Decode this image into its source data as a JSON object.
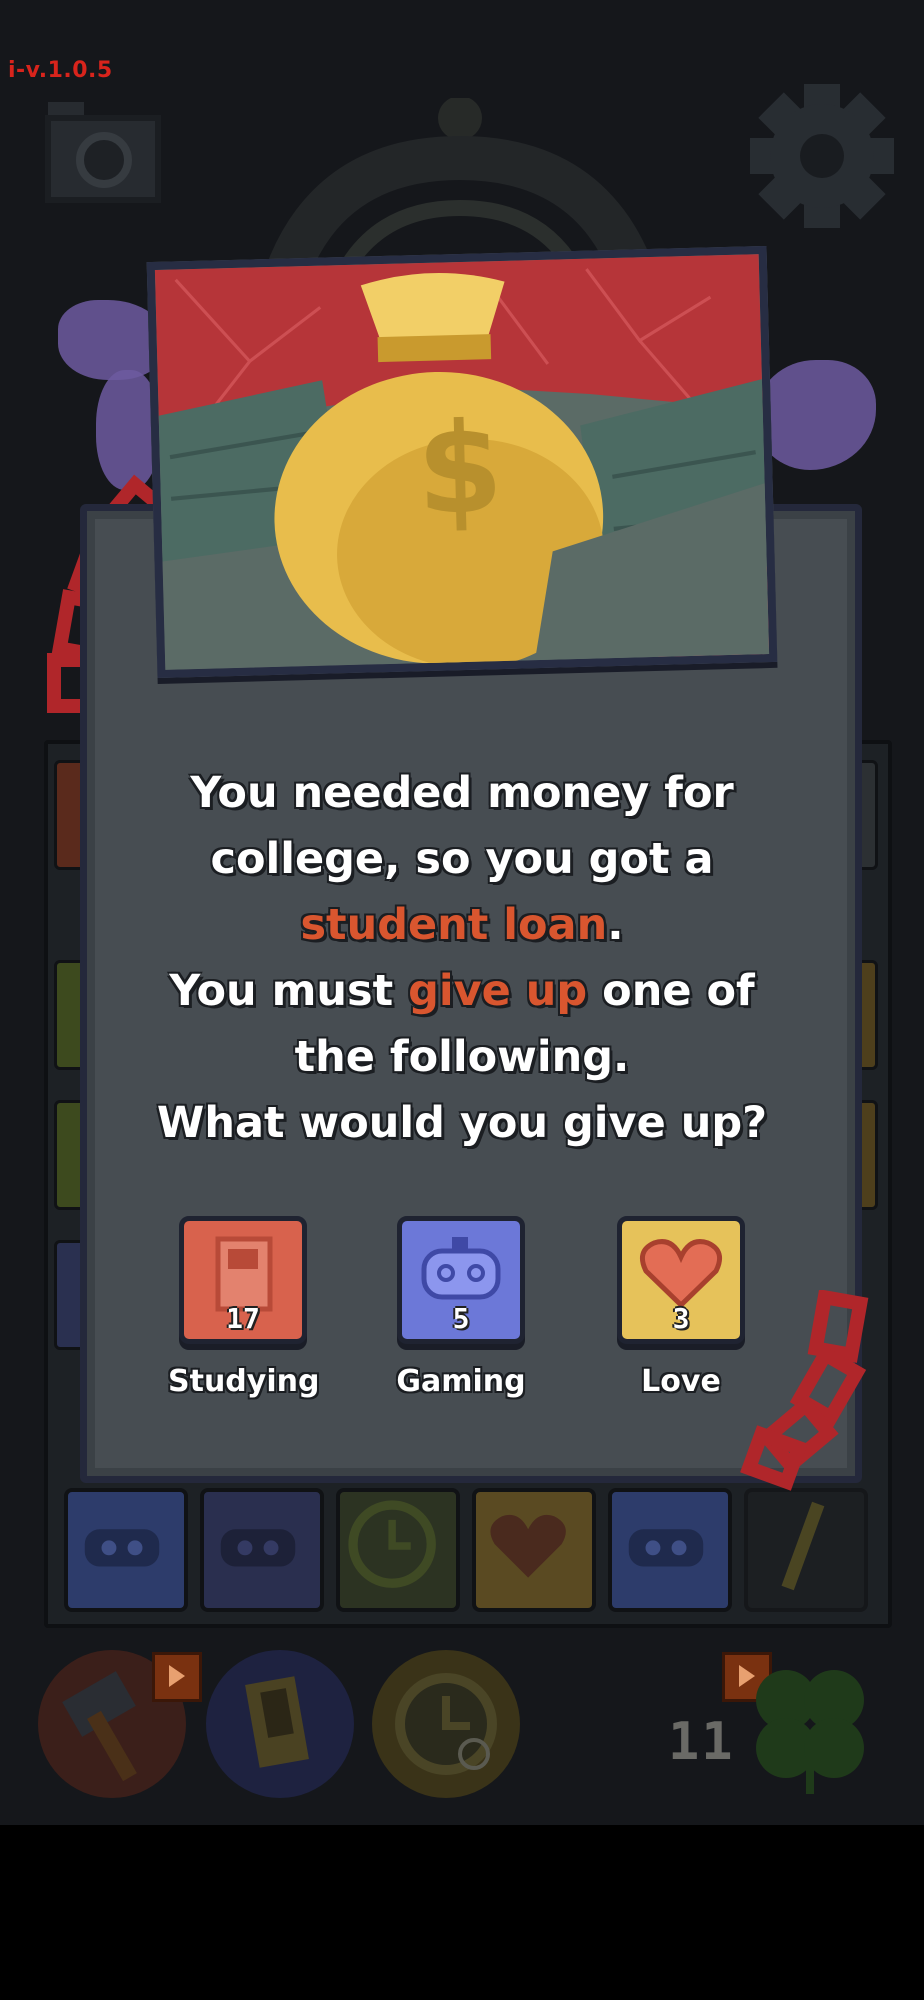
{
  "version": "i-v.1.0.5",
  "background": {
    "camera_icon": "camera-icon",
    "settings_icon": "gear-icon",
    "turn_counter": "11",
    "slots": [
      {
        "icon": "gamepad-icon",
        "color": "#2d3c6b"
      },
      {
        "icon": "gamepad-icon",
        "color": "#2a2f4f"
      },
      {
        "icon": "clock-icon",
        "color": "#2c3322"
      },
      {
        "icon": "heart-icon",
        "color": "#5a4a22"
      },
      {
        "icon": "gamepad-icon",
        "color": "#2d3c6b"
      },
      {
        "icon": "pencil-icon",
        "color": "#2a2a22"
      }
    ],
    "tools": [
      {
        "icon": "hammer-icon",
        "ad": true
      },
      {
        "icon": "book-icon",
        "ad": false
      },
      {
        "icon": "clock-icon",
        "ad": false
      },
      {
        "icon": "clover-icon",
        "ad": true
      }
    ]
  },
  "event": {
    "image_icon": "money-bag-icon",
    "prompt": {
      "line1": "You needed money for",
      "line2": "college, so you got a",
      "highlight1": "student loan",
      "line3_end": ".",
      "line4_start": "You must ",
      "highlight2": "give up",
      "line4_end": " one of",
      "line5": "the following.",
      "line6": "What would you give up?"
    },
    "choices": [
      {
        "label": "Studying",
        "value": "17",
        "icon": "book-icon",
        "color": "#d8624d"
      },
      {
        "label": "Gaming",
        "value": "5",
        "icon": "gamepad-icon",
        "color": "#6c78d8"
      },
      {
        "label": "Love",
        "value": "3",
        "icon": "heart-icon",
        "color": "#e6c25a"
      }
    ]
  },
  "colors": {
    "highlight": "#d9562f",
    "version": "#d8241c",
    "card": "#474d52"
  }
}
